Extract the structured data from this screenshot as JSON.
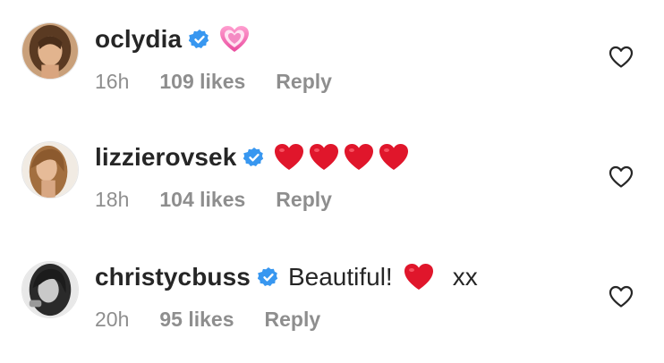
{
  "comments": [
    {
      "username": "oclydia",
      "verified": true,
      "text_before": "",
      "emojis": [
        "sparkling-heart"
      ],
      "text_after": "",
      "time": "16h",
      "likes": "109 likes",
      "reply": "Reply",
      "like_icon": "heart-outline-icon"
    },
    {
      "username": "lizzierovsek",
      "verified": true,
      "text_before": "",
      "emojis": [
        "red-heart",
        "red-heart",
        "red-heart",
        "red-heart"
      ],
      "text_after": "",
      "time": "18h",
      "likes": "104 likes",
      "reply": "Reply",
      "like_icon": "heart-outline-icon"
    },
    {
      "username": "christycbuss",
      "verified": true,
      "text_before": "Beautiful!",
      "emojis": [
        "red-heart"
      ],
      "text_after": "xx",
      "time": "20h",
      "likes": "95 likes",
      "reply": "Reply",
      "like_icon": "heart-outline-icon"
    }
  ],
  "colors": {
    "username": "#262626",
    "meta": "#8e8e8e",
    "verified_badge": "#3897f0",
    "red_heart": "#e0162b",
    "sparkling_heart": "#f06cb0"
  }
}
